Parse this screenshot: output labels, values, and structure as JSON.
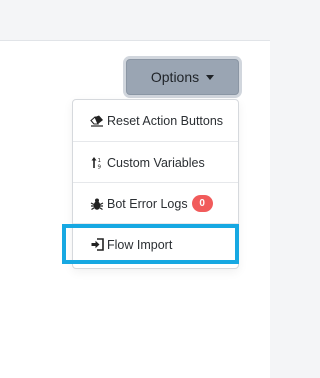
{
  "toolbar": {
    "options_label": "Options"
  },
  "dropdown": {
    "items": [
      {
        "label": "Reset Action Buttons",
        "icon": "eraser-icon"
      },
      {
        "label": "Custom Variables",
        "icon": "sort-arrows-icon"
      },
      {
        "label": "Bot Error Logs",
        "icon": "bug-icon",
        "badge": "0"
      },
      {
        "label": "Flow Import",
        "icon": "sign-in-icon"
      }
    ]
  },
  "colors": {
    "button_bg": "#9aa5b3",
    "badge_bg": "#f15b5b",
    "highlight_border": "#17a8e2"
  }
}
